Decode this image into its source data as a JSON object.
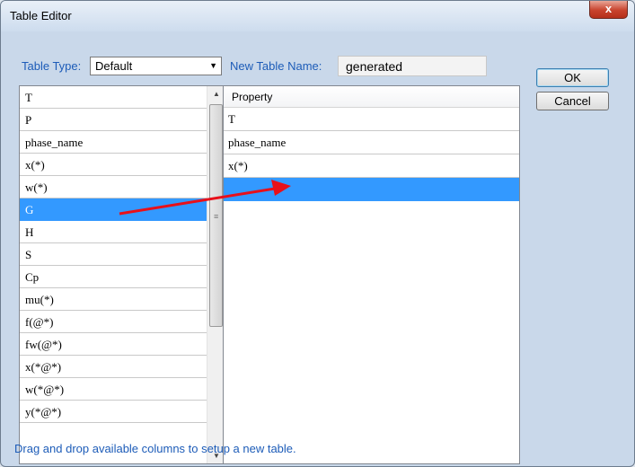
{
  "window": {
    "title": "Table Editor",
    "close_label": "x"
  },
  "table_type": {
    "label": "Table Type:",
    "value": "Default"
  },
  "new_table_name": {
    "label": "New Table Name:",
    "value": "generated"
  },
  "buttons": {
    "ok": "OK",
    "cancel": "Cancel"
  },
  "available_columns": [
    "T",
    "P",
    "phase_name",
    "x(*)",
    "w(*)",
    "G",
    "H",
    "S",
    "Cp",
    "mu(*)",
    "f(@*)",
    "fw(@*)",
    "x(*@*)",
    "w(*@*)",
    "y(*@*)"
  ],
  "selected_available_index": 5,
  "new_table": {
    "header": "Property",
    "rows": [
      "T",
      "phase_name",
      "x(*)",
      ""
    ]
  },
  "status_text": "Drag and drop available columns to setup a new table.",
  "colors": {
    "accent": "#1d5cb8",
    "selection": "#3399ff",
    "drag_arrow": "#e8101a"
  }
}
